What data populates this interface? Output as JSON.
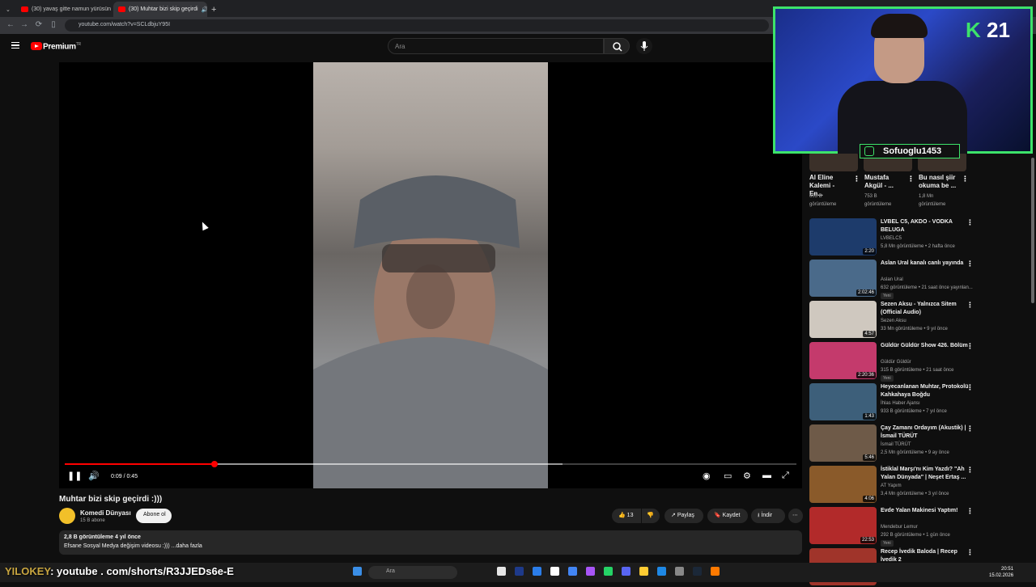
{
  "browser": {
    "tabs": [
      {
        "label": "(30) yavaş gitte namun yürüsün"
      },
      {
        "label": "(30) Muhtar bizi skip geçirdi"
      }
    ],
    "url": "youtube.com/watch?v=SCLdbjuY95I"
  },
  "header": {
    "logo_label": "Premium",
    "logo_sup": "TR",
    "search_placeholder": "Ara"
  },
  "player": {
    "time": "0:09 / 0:45",
    "progress": 0.205,
    "buffered": 0.68
  },
  "video": {
    "title": "Muhtar bizi skip geçirdi :)))",
    "channel": "Komedi Dünyası",
    "subscribers": "15 B abone",
    "subscribe_label": "Abone ol",
    "likes": "13",
    "share_label": "Paylaş",
    "save_label": "Kaydet",
    "download_label": "İndir",
    "description_stats": "2,8 B görüntüleme  4 yıl önce",
    "description_text": "Efsane Sosyal Medya değişim videosu :))) ...daha fazla"
  },
  "shorts": [
    {
      "title": "Al Eline Kalemi - En...",
      "views": "605 B görüntüleme"
    },
    {
      "title": "Mustafa Akgül - ...",
      "views": "753 B görüntüleme"
    },
    {
      "title": "Bu nasıl şiir okuma be ...",
      "views": "1,8 Mn görüntüleme"
    }
  ],
  "recommendations": [
    {
      "title": "LVBEL C5, AKDO - VODKA BELUGA",
      "channel": "LVBELC5",
      "meta": "5,8 Mn görüntüleme • 2 hafta önce",
      "duration": "2:20",
      "badge": "",
      "color": "#1d3b6b"
    },
    {
      "title": "Aslan Ural  kanalı canlı yayında",
      "channel": "Aslan Ural",
      "meta": "632 görüntüleme • 21 saat önce yayınlan...",
      "duration": "2:02:46",
      "badge": "Yeni",
      "color": "#4a6a8a"
    },
    {
      "title": "Sezen Aksu - Yalnızca Sitem (Official Audio)",
      "channel": "Sezen Aksu",
      "meta": "33 Mn görüntüleme • 9 yıl önce",
      "duration": "4:57",
      "badge": "",
      "color": "#cfc8bf"
    },
    {
      "title": "Güldür Güldür Show 426. Bölüm",
      "channel": "Güldür Güldür",
      "meta": "315 B görüntüleme • 21 saat önce",
      "duration": "2:20:36",
      "badge": "Yeni",
      "color": "#c43a6c"
    },
    {
      "title": "Heyecanlanan Muhtar, Protokolü Kahkahaya Boğdu",
      "channel": "İhlas Haber Ajansı",
      "meta": "933 B görüntüleme • 7 yıl önce",
      "duration": "1:43",
      "badge": "",
      "color": "#3d5f7a"
    },
    {
      "title": "Çay Zamanı Ordayım (Akustik) | İsmail TÜRÜT",
      "channel": "İsmail TÜRÜT",
      "meta": "2,5 Mn görüntüleme • 9 ay önce",
      "duration": "5:46",
      "badge": "",
      "color": "#6e5a48"
    },
    {
      "title": "İstiklal Marşı'nı Kim Yazdı? \"Ah Yalan Dünyada\" | Neşet Ertaş ...",
      "channel": "AT Yapım",
      "meta": "3,4 Mn görüntüleme • 3 yıl önce",
      "duration": "4:06",
      "badge": "",
      "color": "#8a5a2a"
    },
    {
      "title": "Evde Yalan Makinesi Yaptım!",
      "channel": "Mendebur Lemur",
      "meta": "292 B görüntüleme • 1 gün önce",
      "duration": "22:53",
      "badge": "Yeni",
      "color": "#b22a2a"
    },
    {
      "title": "Recep İvedik Baloda | Recep İvedik 2",
      "channel": "",
      "meta": "",
      "duration": "",
      "badge": "",
      "color": "#a0342a"
    }
  ],
  "webcam": {
    "k_label": "K",
    "num_label": "21",
    "instagram": "Sofuoglu1453"
  },
  "overlay": {
    "name": "YILOKEY",
    "text": ": youtube . com/shorts/R3JJEDs6e-E"
  },
  "taskbar": {
    "search_label": "Ara",
    "time": "20:51",
    "date": "15.02.2026"
  }
}
